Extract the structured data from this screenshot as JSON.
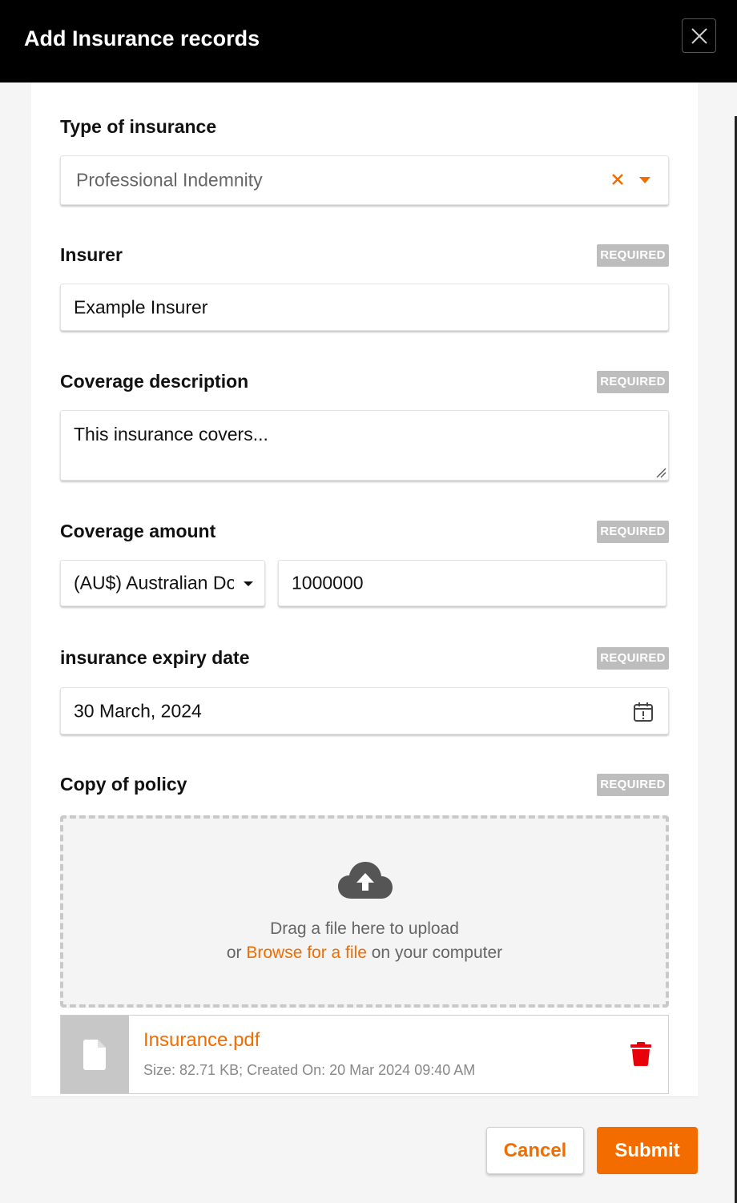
{
  "dialog": {
    "title": "Add Insurance records",
    "close_icon": "close-icon"
  },
  "colors": {
    "accent": "#f26c00",
    "header_bg": "#000000",
    "required_badge": "#bdbdbd",
    "delete": "#e8000b"
  },
  "form": {
    "required_text": "REQUIRED",
    "type_of_insurance": {
      "label": "Type of insurance",
      "value": "Professional Indemnity"
    },
    "insurer": {
      "label": "Insurer",
      "value": "Example Insurer"
    },
    "coverage_description": {
      "label": "Coverage description",
      "value": "This insurance covers..."
    },
    "coverage_amount": {
      "label": "Coverage amount",
      "currency": "(AU$) Australian Dollar",
      "amount": "1000000"
    },
    "expiry_date": {
      "label": "insurance expiry date",
      "value": "30 March, 2024"
    },
    "copy_of_policy": {
      "label": "Copy of policy",
      "drag_text": "Drag a file here to upload",
      "or_text": "or",
      "browse_text": "Browse for a file",
      "suffix_text": "on your computer",
      "file": {
        "name": "Insurance.pdf",
        "meta": "Size: 82.71 KB; Created On: 20 Mar 2024 09:40 AM"
      }
    }
  },
  "footer": {
    "cancel_label": "Cancel",
    "submit_label": "Submit"
  }
}
